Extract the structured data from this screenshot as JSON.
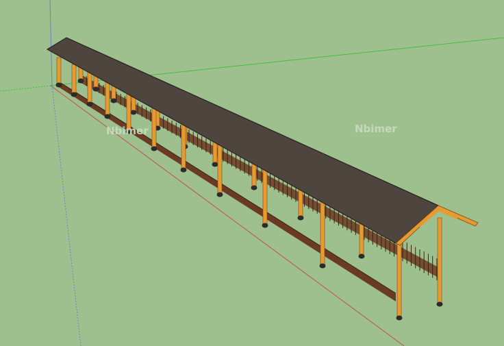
{
  "scene": {
    "background_color": "#9ec08e",
    "axis_colors": {
      "green": "#3fbf3f",
      "red": "#c0504d",
      "blue": "#5f86c8"
    },
    "roof_color": "#4e453f",
    "timber_color": "#e59a32",
    "footing_color": "#2b2b2b",
    "railing_color": "#6b3a22"
  },
  "watermarks": [
    {
      "text": "Nbimer"
    },
    {
      "text": "Nbimer"
    }
  ]
}
